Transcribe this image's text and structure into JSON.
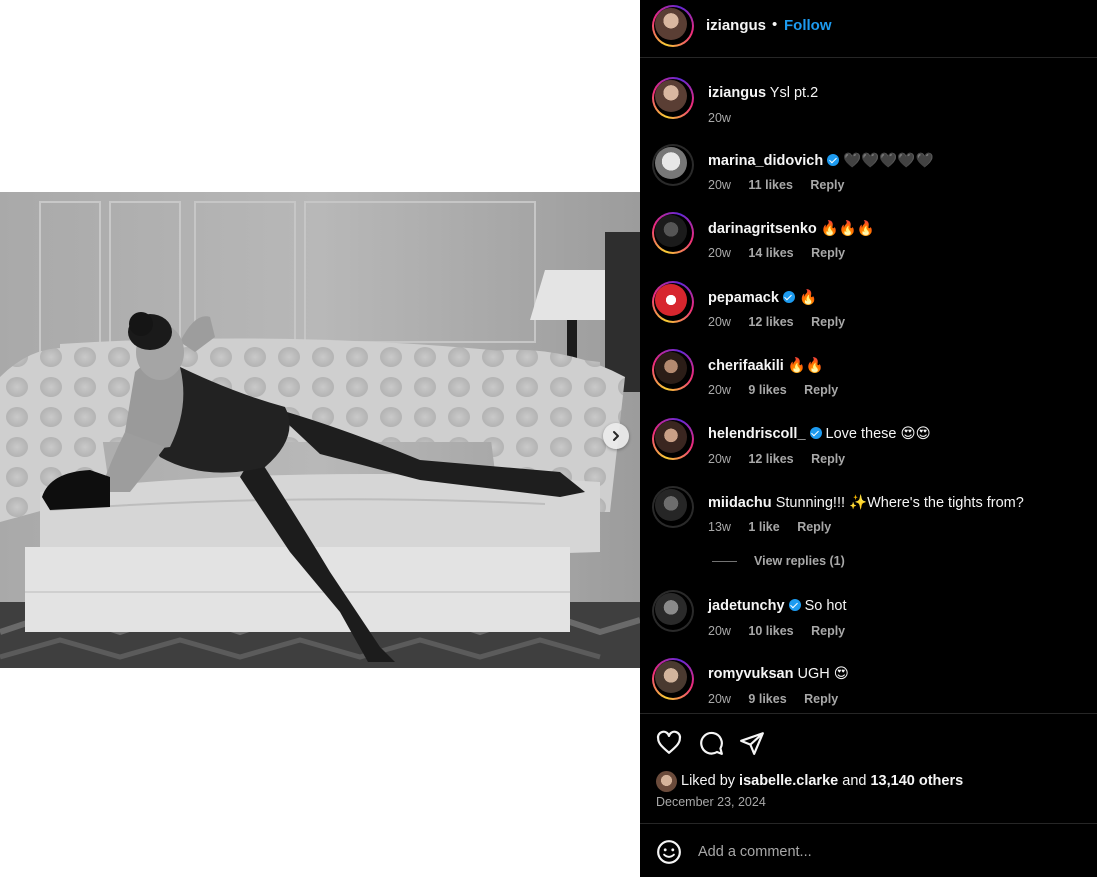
{
  "post": {
    "username": "iziangus",
    "separator": "•",
    "follow_label": "Follow"
  },
  "caption": {
    "username": "iziangus",
    "text": "Ysl pt.2",
    "age": "20w"
  },
  "comments": [
    {
      "username": "marina_didovich",
      "verified": true,
      "text": "🖤🖤🖤🖤🖤",
      "age": "20w",
      "likes": "11 likes",
      "reply": "Reply"
    },
    {
      "username": "darinagritsenko",
      "verified": false,
      "text": "🔥🔥🔥",
      "age": "20w",
      "likes": "14 likes",
      "reply": "Reply"
    },
    {
      "username": "pepamack",
      "verified": true,
      "text": "🔥",
      "age": "20w",
      "likes": "12 likes",
      "reply": "Reply"
    },
    {
      "username": "cherifaakili",
      "verified": false,
      "text": "🔥🔥",
      "age": "20w",
      "likes": "9 likes",
      "reply": "Reply"
    },
    {
      "username": "helendriscoll_",
      "verified": true,
      "text": "Love these 😍😍",
      "age": "20w",
      "likes": "12 likes",
      "reply": "Reply"
    },
    {
      "username": "miidachu",
      "verified": false,
      "text": "Stunning!!! ✨Where's the tights from?",
      "age": "13w",
      "likes": "1 like",
      "reply": "Reply"
    },
    {
      "username": "jadetunchy",
      "verified": true,
      "text": "So hot",
      "age": "20w",
      "likes": "10 likes",
      "reply": "Reply"
    },
    {
      "username": "romyvuksan",
      "verified": false,
      "text": "UGH 😍",
      "age": "20w",
      "likes": "9 likes",
      "reply": "Reply"
    }
  ],
  "view_replies": "View replies (1)",
  "likes": {
    "prefix": "Liked by",
    "first_user": "isabelle.clarke",
    "conj": "and",
    "others": "13,140 others"
  },
  "date": "December 23, 2024",
  "add_comment": {
    "placeholder": "Add a comment..."
  },
  "icons": {
    "like": "heart-icon",
    "comment": "comment-icon",
    "share": "send-icon",
    "emoji": "emoji-icon",
    "next": "chevron-right-icon",
    "verified": "verified-badge-icon"
  },
  "colors": {
    "panel_bg": "#000000",
    "link_blue": "#1d9bf0",
    "muted_text": "#a8a8a8",
    "divider": "#262626"
  }
}
